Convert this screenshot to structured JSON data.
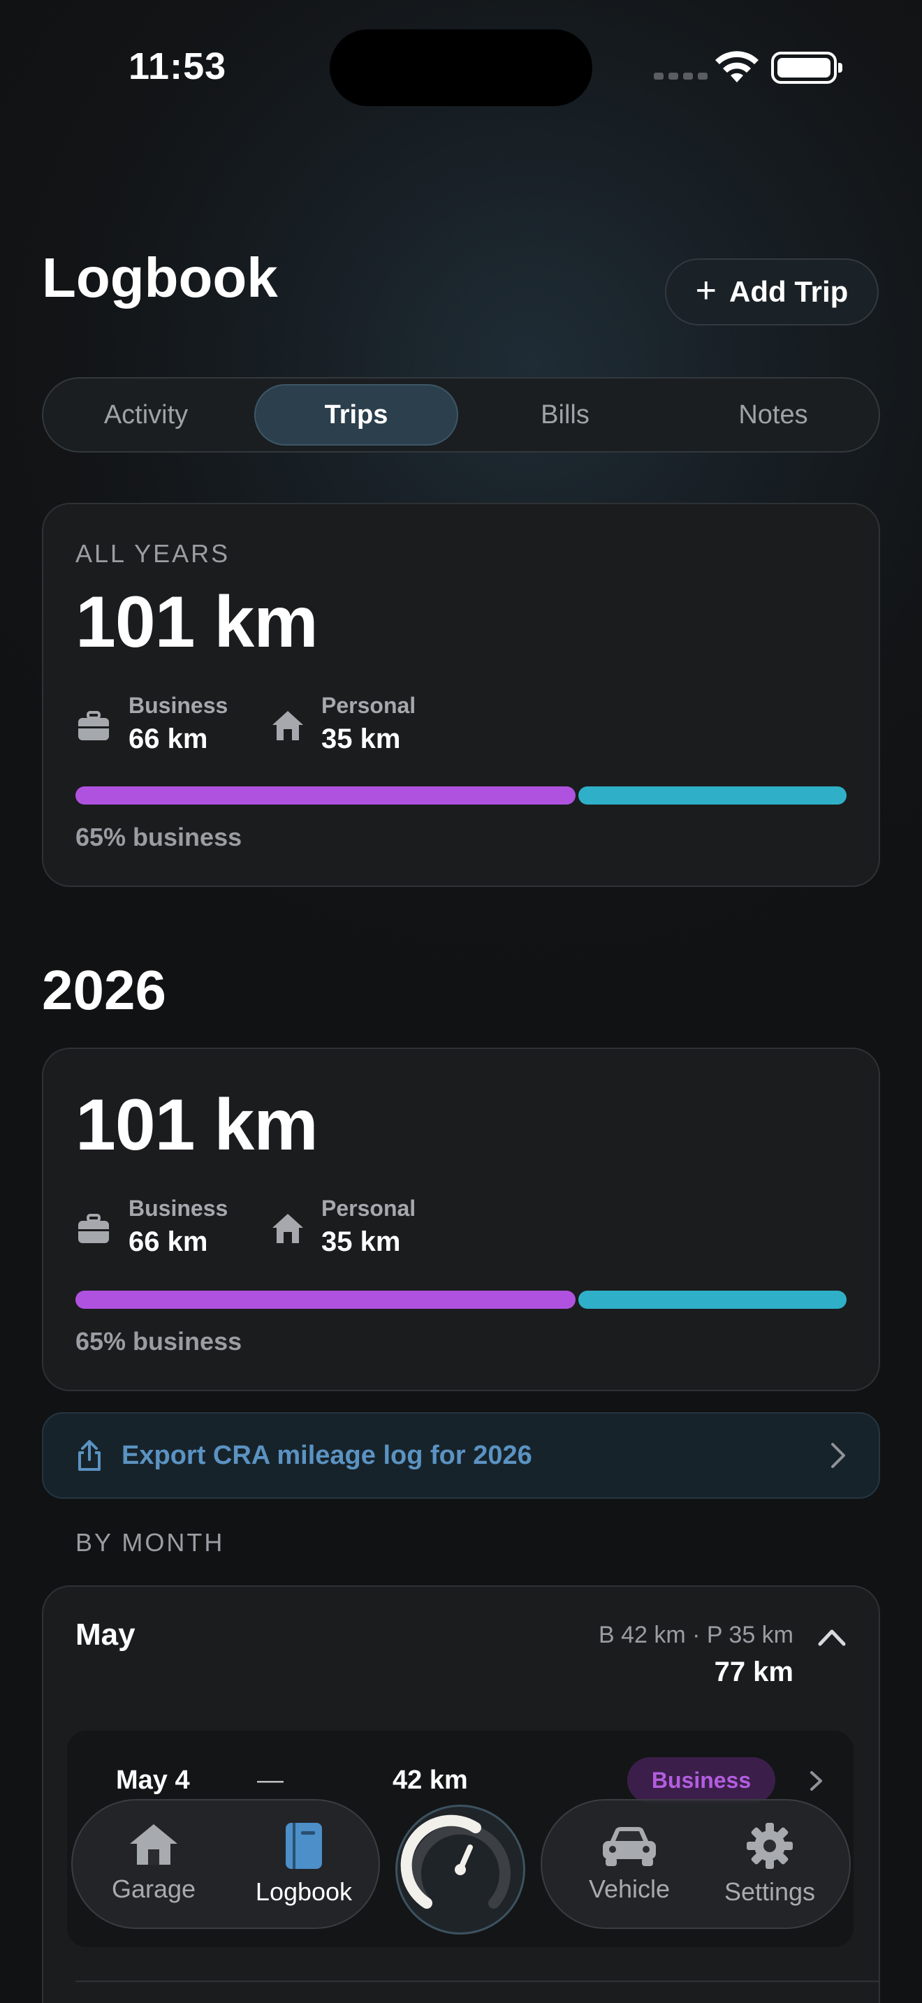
{
  "status_bar": {
    "time": "11:53"
  },
  "header": {
    "title": "Logbook",
    "add_trip_label": "Add Trip"
  },
  "tabs": [
    {
      "label": "Activity",
      "active": false
    },
    {
      "label": "Trips",
      "active": true
    },
    {
      "label": "Bills",
      "active": false
    },
    {
      "label": "Notes",
      "active": false
    }
  ],
  "all_years": {
    "eyebrow": "ALL YEARS",
    "total": "101 km",
    "business_label": "Business",
    "business_value": "66 km",
    "personal_label": "Personal",
    "personal_value": "35 km",
    "business_fraction": 0.65,
    "percent_text": "65% business"
  },
  "year": {
    "title": "2026",
    "total": "101 km",
    "business_label": "Business",
    "business_value": "66 km",
    "personal_label": "Personal",
    "personal_value": "35 km",
    "business_fraction": 0.65,
    "percent_text": "65% business"
  },
  "export": {
    "label": "Export CRA mileage log for 2026"
  },
  "by_month": {
    "heading": "BY MONTH",
    "month": "May",
    "split": "B 42 km · P 35 km",
    "total": "77 km",
    "trips": [
      {
        "date": "May 4",
        "dash": "—",
        "distance": "42 km",
        "tag": "Business"
      }
    ]
  },
  "tab_bar": {
    "garage": "Garage",
    "logbook": "Logbook",
    "vehicle": "Vehicle",
    "settings": "Settings",
    "active": "logbook"
  },
  "colors": {
    "business": "#b052e0",
    "personal": "#2fb0c8",
    "accent_blue": "#5b93c2",
    "active_tab_icon": "#4c8fc9"
  },
  "icons": {
    "business": "briefcase-icon",
    "personal": "house-icon",
    "export": "share-icon",
    "garage": "house-icon",
    "logbook": "book-icon",
    "vehicle": "car-icon",
    "settings": "gear-icon",
    "center": "speedometer-icon"
  }
}
